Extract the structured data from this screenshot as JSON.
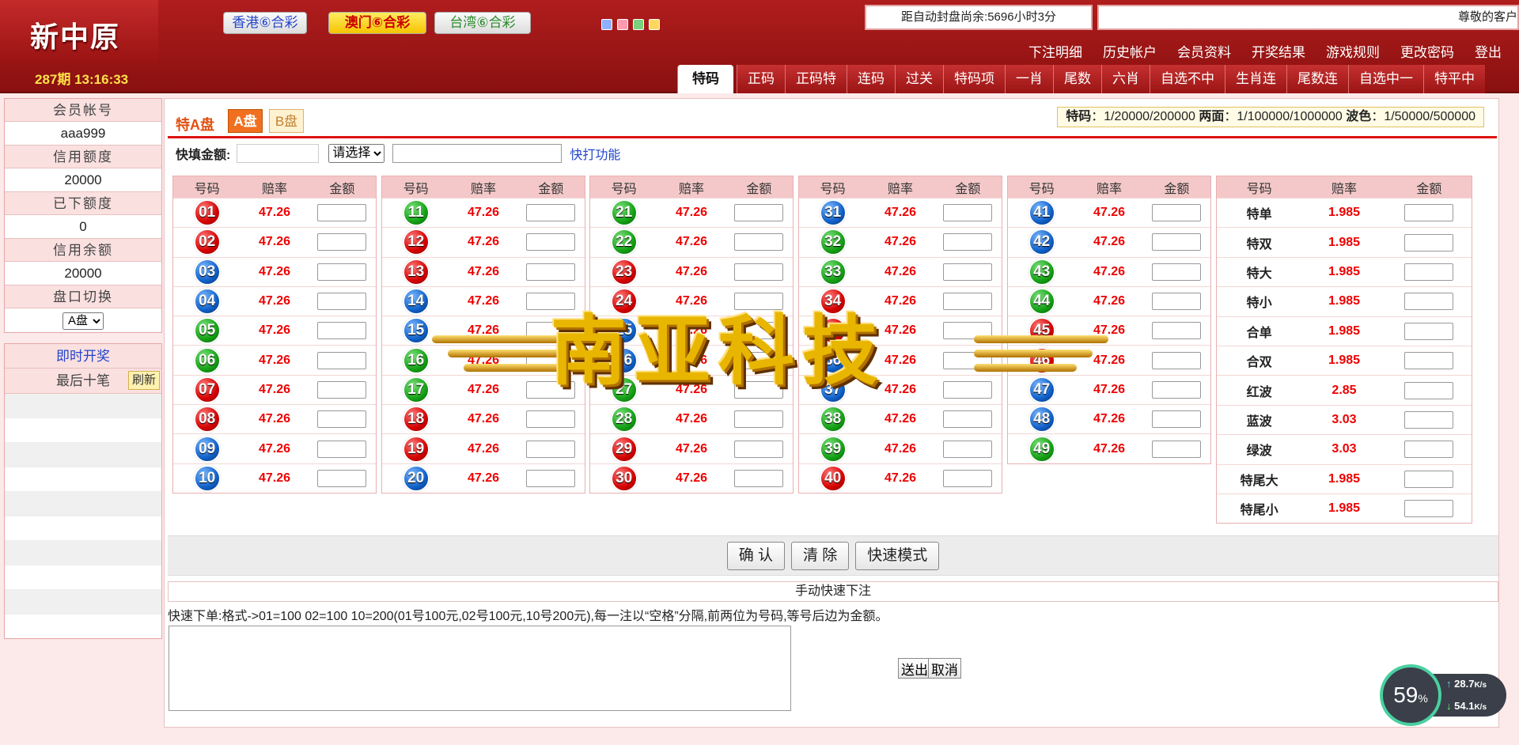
{
  "header": {
    "logo": "新中原",
    "period": "287期 13:16:33",
    "lotteries": [
      "香港⑥合彩",
      "澳门⑥合彩",
      "台湾⑥合彩"
    ],
    "countdown": "距自动封盘尚余:5696小时3分",
    "marquee": "尊敬的客户",
    "topnav": [
      "下注明细",
      "历史帐户",
      "会员资料",
      "开奖结果",
      "游戏规则",
      "更改密码",
      "登出"
    ],
    "gametabs": [
      "特码",
      "正码",
      "正码特",
      "连码",
      "过关",
      "特码项",
      "一肖",
      "尾数",
      "六肖",
      "自选不中",
      "生肖连",
      "尾数连",
      "自选中一",
      "特平中"
    ]
  },
  "sidebar": {
    "account_label": "会员帐号",
    "account": "aaa999",
    "credit_label": "信用额度",
    "credit": "20000",
    "placed_label": "已下额度",
    "placed": "0",
    "balance_label": "信用余额",
    "balance": "20000",
    "switch_label": "盘口切换",
    "switch_value": "A盘",
    "live_label": "即时开奖",
    "last_label": "最后十笔",
    "refresh_label": "刷新"
  },
  "main": {
    "title": "特A盘",
    "btn_a": "A盘",
    "btn_b": "B盘",
    "limits_1_label": "特码",
    "limits_1": "：1/20000/200000",
    "limits_2_label": "两面",
    "limits_2": "：1/100000/1000000",
    "limits_3_label": "波色",
    "limits_3": "：1/50000/500000",
    "quick_label": "快填金额:",
    "quick_select": "请选择",
    "quick_link": "快打功能",
    "col_headers": {
      "num": "号码",
      "odds": "赔率",
      "amount": "金额"
    },
    "odds": "47.26",
    "balls": [
      {
        "n": "01",
        "c": "red"
      },
      {
        "n": "02",
        "c": "red"
      },
      {
        "n": "03",
        "c": "blue"
      },
      {
        "n": "04",
        "c": "blue"
      },
      {
        "n": "05",
        "c": "green"
      },
      {
        "n": "06",
        "c": "green"
      },
      {
        "n": "07",
        "c": "red"
      },
      {
        "n": "08",
        "c": "red"
      },
      {
        "n": "09",
        "c": "blue"
      },
      {
        "n": "10",
        "c": "blue"
      },
      {
        "n": "11",
        "c": "green"
      },
      {
        "n": "12",
        "c": "red"
      },
      {
        "n": "13",
        "c": "red"
      },
      {
        "n": "14",
        "c": "blue"
      },
      {
        "n": "15",
        "c": "blue"
      },
      {
        "n": "16",
        "c": "green"
      },
      {
        "n": "17",
        "c": "green"
      },
      {
        "n": "18",
        "c": "red"
      },
      {
        "n": "19",
        "c": "red"
      },
      {
        "n": "20",
        "c": "blue"
      },
      {
        "n": "21",
        "c": "green"
      },
      {
        "n": "22",
        "c": "green"
      },
      {
        "n": "23",
        "c": "red"
      },
      {
        "n": "24",
        "c": "red"
      },
      {
        "n": "25",
        "c": "blue"
      },
      {
        "n": "26",
        "c": "blue"
      },
      {
        "n": "27",
        "c": "green"
      },
      {
        "n": "28",
        "c": "green"
      },
      {
        "n": "29",
        "c": "red"
      },
      {
        "n": "30",
        "c": "red"
      },
      {
        "n": "31",
        "c": "blue"
      },
      {
        "n": "32",
        "c": "green"
      },
      {
        "n": "33",
        "c": "green"
      },
      {
        "n": "34",
        "c": "red"
      },
      {
        "n": "35",
        "c": "red"
      },
      {
        "n": "36",
        "c": "blue"
      },
      {
        "n": "37",
        "c": "blue"
      },
      {
        "n": "38",
        "c": "green"
      },
      {
        "n": "39",
        "c": "green"
      },
      {
        "n": "40",
        "c": "red"
      },
      {
        "n": "41",
        "c": "blue"
      },
      {
        "n": "42",
        "c": "blue"
      },
      {
        "n": "43",
        "c": "green"
      },
      {
        "n": "44",
        "c": "green"
      },
      {
        "n": "45",
        "c": "red"
      },
      {
        "n": "46",
        "c": "red"
      },
      {
        "n": "47",
        "c": "blue"
      },
      {
        "n": "48",
        "c": "blue"
      },
      {
        "n": "49",
        "c": "green"
      }
    ],
    "special": [
      {
        "name": "特单",
        "odds": "1.985"
      },
      {
        "name": "特双",
        "odds": "1.985"
      },
      {
        "name": "特大",
        "odds": "1.985"
      },
      {
        "name": "特小",
        "odds": "1.985"
      },
      {
        "name": "合单",
        "odds": "1.985"
      },
      {
        "name": "合双",
        "odds": "1.985"
      },
      {
        "name": "红波",
        "odds": "2.85"
      },
      {
        "name": "蓝波",
        "odds": "3.03"
      },
      {
        "name": "绿波",
        "odds": "3.03"
      },
      {
        "name": "特尾大",
        "odds": "1.985"
      },
      {
        "name": "特尾小",
        "odds": "1.985"
      }
    ],
    "watermark": "南亚科技",
    "btn_confirm": "确 认",
    "btn_clear": "清 除",
    "btn_fast": "快速模式",
    "manual_title": "手动快速下注",
    "manual_desc": "快速下单:格式->01=100 02=100 10=200(01号100元,02号100元,10号200元),每一注以“空格”分隔,前两位为号码,等号后边为金额。",
    "manual_send": "送出",
    "manual_cancel": "取消"
  },
  "speed": {
    "percent": "59",
    "unit": "%",
    "up": "28.7",
    "down": "54.1",
    "speed_unit": "K/s"
  },
  "colors": {
    "header": "#9a1414",
    "accent": "#e00000",
    "ball_red": "#d40000",
    "ball_blue": "#1060c8",
    "ball_green": "#14a014"
  }
}
